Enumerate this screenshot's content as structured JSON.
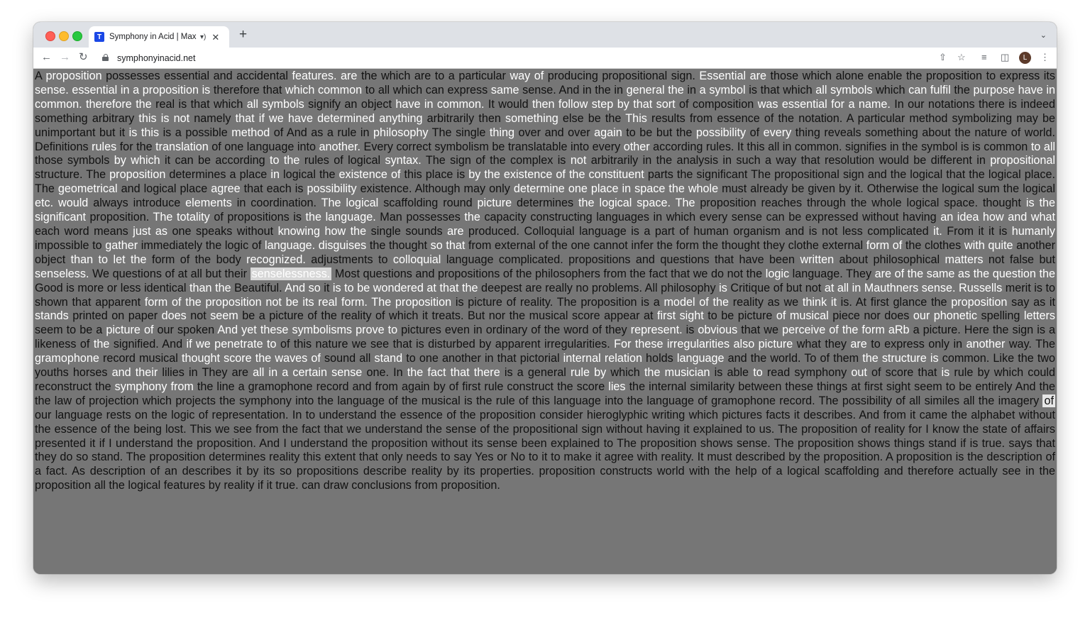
{
  "browser": {
    "tab_title": "Symphony in Acid | Max Cooper",
    "favicon_letter": "T",
    "audio_icon": "speaker-icon",
    "url": "symphonyinacid.net",
    "avatar_letter": "L"
  },
  "segments": [
    [
      "A ",
      ""
    ],
    [
      "proposition",
      "w"
    ],
    [
      " possesses essential and accidental ",
      ""
    ],
    [
      "features. are",
      "w"
    ],
    [
      " the which are to a particular ",
      ""
    ],
    [
      "way of",
      "w"
    ],
    [
      " producing propositional sign. ",
      ""
    ],
    [
      "Essential are",
      "w"
    ],
    [
      " those which alone enable the proposition to express its ",
      ""
    ],
    [
      "sense. essential in a proposition is",
      "w"
    ],
    [
      " therefore that ",
      ""
    ],
    [
      "which common",
      "w"
    ],
    [
      " to all which can express ",
      ""
    ],
    [
      "same",
      "w"
    ],
    [
      " sense. And in the in ",
      ""
    ],
    [
      "general the",
      "w"
    ],
    [
      " in ",
      ""
    ],
    [
      "a symbol",
      "w"
    ],
    [
      " is that which ",
      ""
    ],
    [
      "all symbols",
      "w"
    ],
    [
      " which ",
      ""
    ],
    [
      "can fulfil",
      "w"
    ],
    [
      " the ",
      ""
    ],
    [
      "purpose have in common.",
      "w"
    ],
    [
      " ",
      ""
    ],
    [
      "therefore",
      "w"
    ],
    [
      " ",
      ""
    ],
    [
      "the",
      "w"
    ],
    [
      " real is that which ",
      ""
    ],
    [
      "all symbols",
      "w"
    ],
    [
      " signify an object ",
      ""
    ],
    [
      "have in common.",
      "w"
    ],
    [
      " It would ",
      ""
    ],
    [
      "then follow",
      "w"
    ],
    [
      " ",
      ""
    ],
    [
      "step",
      "w"
    ],
    [
      " ",
      ""
    ],
    [
      "by that sort",
      "w"
    ],
    [
      " of composition ",
      ""
    ],
    [
      "was essential for a name.",
      "w"
    ],
    [
      " In our notations there is indeed something arbitrary ",
      ""
    ],
    [
      "this is not",
      "w"
    ],
    [
      " namely ",
      ""
    ],
    [
      "that if we have",
      "w"
    ],
    [
      " ",
      ""
    ],
    [
      "determined anything",
      "w"
    ],
    [
      " arbitrarily then ",
      ""
    ],
    [
      "something",
      "w"
    ],
    [
      " else be the ",
      ""
    ],
    [
      "This",
      "w"
    ],
    [
      " results from essence of the notation. A particular method symbolizing may be unimportant but it ",
      ""
    ],
    [
      "is this",
      "w"
    ],
    [
      " is a possible ",
      ""
    ],
    [
      "method",
      "w"
    ],
    [
      " of And as a rule in ",
      ""
    ],
    [
      "philosophy",
      "w"
    ],
    [
      " The single ",
      ""
    ],
    [
      "thing",
      "w"
    ],
    [
      " over and over ",
      ""
    ],
    [
      "again",
      "w"
    ],
    [
      " to be but the ",
      ""
    ],
    [
      "possibility",
      "w"
    ],
    [
      " of ",
      ""
    ],
    [
      "every",
      "w"
    ],
    [
      " thing reveals something about the nature of world. Definitions ",
      ""
    ],
    [
      "rules",
      "w"
    ],
    [
      " for the ",
      ""
    ],
    [
      "translation",
      "w"
    ],
    [
      " of one language into ",
      ""
    ],
    [
      "another.",
      "w"
    ],
    [
      " Every correct symbolism be translatable into every ",
      ""
    ],
    [
      "other",
      "w"
    ],
    [
      " according rules. It this all in common. signifies in the symbol is is common ",
      ""
    ],
    [
      "to all",
      "w"
    ],
    [
      " those symbols ",
      ""
    ],
    [
      "by which",
      "w"
    ],
    [
      " it can be according ",
      ""
    ],
    [
      "to the",
      "w"
    ],
    [
      " rules of logical ",
      ""
    ],
    [
      "syntax.",
      "w"
    ],
    [
      " The sign of the complex is ",
      ""
    ],
    [
      "not",
      "w"
    ],
    [
      " arbitrarily in the analysis in such a way that resolution would be different in ",
      ""
    ],
    [
      "propositional",
      "w"
    ],
    [
      " structure. The ",
      ""
    ],
    [
      "proposition",
      "w"
    ],
    [
      " determines a place ",
      ""
    ],
    [
      "in",
      "w"
    ],
    [
      " logical the ",
      ""
    ],
    [
      "existence of",
      "w"
    ],
    [
      " this place is ",
      ""
    ],
    [
      "by the existence",
      "w"
    ],
    [
      " ",
      ""
    ],
    [
      "of the constituent",
      "w"
    ],
    [
      " parts the significant The propositional sign and the logical that the logical place. The ",
      ""
    ],
    [
      "geometrical",
      "w"
    ],
    [
      " and logical place ",
      ""
    ],
    [
      "agree",
      "w"
    ],
    [
      " that each is ",
      ""
    ],
    [
      "possibility",
      "w"
    ],
    [
      " existence. Although may only ",
      ""
    ],
    [
      "determine one place in space the whole",
      "w"
    ],
    [
      " must already be given by it. Otherwise the logical sum the logical ",
      ""
    ],
    [
      "etc. would",
      "w"
    ],
    [
      " always introduce ",
      ""
    ],
    [
      "elements",
      "w"
    ],
    [
      " in coordination. ",
      ""
    ],
    [
      "The logical",
      "w"
    ],
    [
      " scaffolding round ",
      ""
    ],
    [
      "picture",
      "w"
    ],
    [
      " determines ",
      ""
    ],
    [
      "the logical space. The",
      "w"
    ],
    [
      " proposition reaches through the whole logical space. thought ",
      ""
    ],
    [
      "is the significant",
      "w"
    ],
    [
      " proposition. ",
      ""
    ],
    [
      "The totality",
      "w"
    ],
    [
      " of propositions is ",
      ""
    ],
    [
      "the language.",
      "w"
    ],
    [
      " Man possesses ",
      ""
    ],
    [
      "the",
      "w"
    ],
    [
      " capacity constructing languages in which every sense can be expressed without having ",
      ""
    ],
    [
      "an idea how",
      "w"
    ],
    [
      " ",
      ""
    ],
    [
      "and what",
      "w"
    ],
    [
      " each word means ",
      ""
    ],
    [
      "just as",
      "w"
    ],
    [
      " one speaks without ",
      ""
    ],
    [
      "knowing how the",
      "w"
    ],
    [
      " single sounds ",
      ""
    ],
    [
      "are",
      "w"
    ],
    [
      " produced. Colloquial language is a part of human organism and is not less complicated ",
      ""
    ],
    [
      "it.",
      "w"
    ],
    [
      " From it it is ",
      ""
    ],
    [
      "humanly",
      "w"
    ],
    [
      " impossible to ",
      ""
    ],
    [
      "gather",
      "w"
    ],
    [
      " immediately the logic of ",
      ""
    ],
    [
      "language. disguises",
      "w"
    ],
    [
      " the thought ",
      ""
    ],
    [
      "so that",
      "w"
    ],
    [
      " from external of the one cannot infer the form the thought they clothe external ",
      ""
    ],
    [
      "form of",
      "w"
    ],
    [
      " the clothes ",
      ""
    ],
    [
      "with quite",
      "w"
    ],
    [
      " another object ",
      ""
    ],
    [
      "than to let the",
      "w"
    ],
    [
      " form of the body ",
      ""
    ],
    [
      "recognized.",
      "w"
    ],
    [
      " adjustments to ",
      ""
    ],
    [
      "colloquial",
      "w"
    ],
    [
      " language complicated. propositions and questions that have been ",
      ""
    ],
    [
      "written",
      "w"
    ],
    [
      " about philosophical ",
      ""
    ],
    [
      "matters",
      "w"
    ],
    [
      " not false but ",
      ""
    ],
    [
      "senseless.",
      "w"
    ],
    [
      " We questions of at all but their ",
      ""
    ],
    [
      "senselessness.",
      "hl"
    ],
    [
      " Most questions and propositions of the philosophers from the fact that we do not the ",
      ""
    ],
    [
      "logic",
      "w"
    ],
    [
      " language. They ",
      ""
    ],
    [
      "are of the same as the",
      "w"
    ],
    [
      " ",
      ""
    ],
    [
      "question the",
      "w"
    ],
    [
      " Good is more or less identical ",
      ""
    ],
    [
      "than the",
      "w"
    ],
    [
      " Beautiful. ",
      ""
    ],
    [
      "And so",
      "w"
    ],
    [
      " it ",
      ""
    ],
    [
      "is to",
      "w"
    ],
    [
      " ",
      ""
    ],
    [
      "be wondered",
      "w"
    ],
    [
      " ",
      ""
    ],
    [
      "at that the",
      "w"
    ],
    [
      " deepest are really no problems. All philosophy ",
      ""
    ],
    [
      "is",
      "w"
    ],
    [
      " Critique of but not ",
      ""
    ],
    [
      "at all in Mauthners sense. Russells",
      "w"
    ],
    [
      " merit is to shown that apparent ",
      ""
    ],
    [
      "form of the proposition not be its real form. The proposition",
      "w"
    ],
    [
      " is picture of reality. The proposition is a ",
      ""
    ],
    [
      "model of the",
      "w"
    ],
    [
      " reality as we ",
      ""
    ],
    [
      "think it",
      "w"
    ],
    [
      " is. At first glance the ",
      ""
    ],
    [
      "proposition",
      "w"
    ],
    [
      " say as it ",
      ""
    ],
    [
      "stands",
      "w"
    ],
    [
      " printed on paper ",
      ""
    ],
    [
      "does",
      "w"
    ],
    [
      " not ",
      ""
    ],
    [
      "seem",
      "w"
    ],
    [
      " be a picture of the reality of which it treats. But nor the musical score appear at ",
      ""
    ],
    [
      "first sight",
      "w"
    ],
    [
      " to be picture ",
      ""
    ],
    [
      "of musical",
      "w"
    ],
    [
      " piece nor does ",
      ""
    ],
    [
      "our phonetic",
      "w"
    ],
    [
      " spelling ",
      ""
    ],
    [
      "letters",
      "w"
    ],
    [
      " seem to be a ",
      ""
    ],
    [
      "picture of",
      "w"
    ],
    [
      " our spoken ",
      ""
    ],
    [
      "And yet these symbolisms prove to",
      "w"
    ],
    [
      " pictures even in ordinary of the word of they ",
      ""
    ],
    [
      "represent.",
      "w"
    ],
    [
      " is ",
      ""
    ],
    [
      "obvious",
      "w"
    ],
    [
      " that we ",
      ""
    ],
    [
      "perceive of the",
      "w"
    ],
    [
      " ",
      ""
    ],
    [
      "form aRb",
      "w"
    ],
    [
      " a picture. Here the sign is a likeness of ",
      ""
    ],
    [
      "the",
      "w"
    ],
    [
      " signified. And ",
      ""
    ],
    [
      "if we penetrate to",
      "w"
    ],
    [
      " of this nature we see that is disturbed by apparent irregularities. ",
      ""
    ],
    [
      "For these irregularities also picture",
      "w"
    ],
    [
      " what they ",
      ""
    ],
    [
      "are",
      "w"
    ],
    [
      " to express only in ",
      ""
    ],
    [
      "another",
      "w"
    ],
    [
      " way. The ",
      ""
    ],
    [
      "gramophone",
      "w"
    ],
    [
      " record musical ",
      ""
    ],
    [
      "thought score the waves of",
      "w"
    ],
    [
      " sound all ",
      ""
    ],
    [
      "stand",
      "w"
    ],
    [
      " to one another in that pictorial ",
      ""
    ],
    [
      "internal relation",
      "w"
    ],
    [
      " holds ",
      ""
    ],
    [
      "language",
      "w"
    ],
    [
      " and the world. To of them ",
      ""
    ],
    [
      "the structure",
      "w"
    ],
    [
      " ",
      ""
    ],
    [
      "is",
      "w"
    ],
    [
      " common. Like the two youths horses ",
      ""
    ],
    [
      "and their",
      "w"
    ],
    [
      " lilies in They are ",
      ""
    ],
    [
      "all in a certain sense",
      "w"
    ],
    [
      " one. In ",
      ""
    ],
    [
      "the fact that there",
      "w"
    ],
    [
      " is a general ",
      ""
    ],
    [
      "rule",
      "w"
    ],
    [
      " ",
      ""
    ],
    [
      "by",
      "w"
    ],
    [
      " which ",
      ""
    ],
    [
      "the musician",
      "w"
    ],
    [
      " is able ",
      ""
    ],
    [
      "to",
      "w"
    ],
    [
      " read symphony ",
      ""
    ],
    [
      "out",
      "w"
    ],
    [
      " of score that ",
      ""
    ],
    [
      "is",
      "w"
    ],
    [
      " rule by which could reconstruct the ",
      ""
    ],
    [
      "symphony from",
      "w"
    ],
    [
      " the line a gramophone record and from again by of first rule construct the score ",
      ""
    ],
    [
      "lies",
      "w"
    ],
    [
      " the internal similarity between these things at first sight seem to be entirely And the the law of projection which projects the symphony into the language of the musical is the rule of this language into the language of gramophone record. The possibility of all similes all the imagery ",
      ""
    ],
    [
      "of",
      "hl2"
    ],
    [
      " our language rests on the logic of representation. In to understand the essence of the proposition consider hieroglyphic writing which pictures facts it describes. And from it came the alphabet without the essence of the being lost. This we see from the fact that we understand the sense of the propositional sign without having it explained to us. The proposition of reality for I know the state of affairs presented it if I understand the proposition. And I understand the proposition without its sense been explained to The proposition shows sense. The proposition shows things stand if is true. says that they do so stand. The proposition determines reality this extent that only needs to say Yes or No to it to make it agree with reality. It must described by the proposition. A proposition is the description of a fact. As description of an describes it by its so propositions describe reality by its properties. proposition constructs world with the help of a logical scaffolding and therefore actually see in the proposition all the logical features by reality if it true. can draw conclusions from proposition.",
      ""
    ]
  ]
}
